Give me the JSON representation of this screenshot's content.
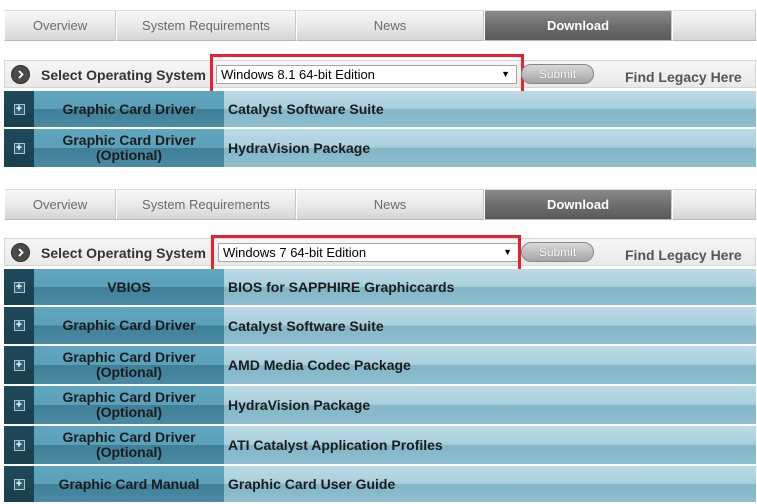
{
  "tabs": [
    "Overview",
    "System Requirements",
    "News",
    "Download"
  ],
  "active_tab": "Download",
  "os_label": "Select Operating System",
  "submit_label": "Submit",
  "legacy_link": "Find Legacy Here",
  "colors": {
    "highlight": "#e8202f",
    "active_tab": "#6e6e6e",
    "row_teal": "#5b9fb8"
  },
  "block1": {
    "selected_os": "Windows 8.1 64-bit Edition",
    "rows": [
      {
        "category": "Graphic Card Driver",
        "sub": "",
        "description": "Catalyst Software Suite"
      },
      {
        "category": "Graphic Card Driver",
        "sub": "(Optional)",
        "description": "HydraVision Package"
      }
    ]
  },
  "block2": {
    "selected_os": "Windows 7 64-bit Edition",
    "rows": [
      {
        "category": "VBIOS",
        "sub": "",
        "description": "BIOS for SAPPHIRE Graphiccards"
      },
      {
        "category": "Graphic Card Driver",
        "sub": "",
        "description": "Catalyst Software Suite"
      },
      {
        "category": "Graphic Card Driver",
        "sub": "(Optional)",
        "description": "AMD Media Codec Package"
      },
      {
        "category": "Graphic Card Driver",
        "sub": "(Optional)",
        "description": "HydraVision Package"
      },
      {
        "category": "Graphic Card Driver",
        "sub": "(Optional)",
        "description": "ATI Catalyst Application Profiles"
      },
      {
        "category": "Graphic Card Manual",
        "sub": "",
        "description": "Graphic Card User Guide"
      }
    ]
  }
}
